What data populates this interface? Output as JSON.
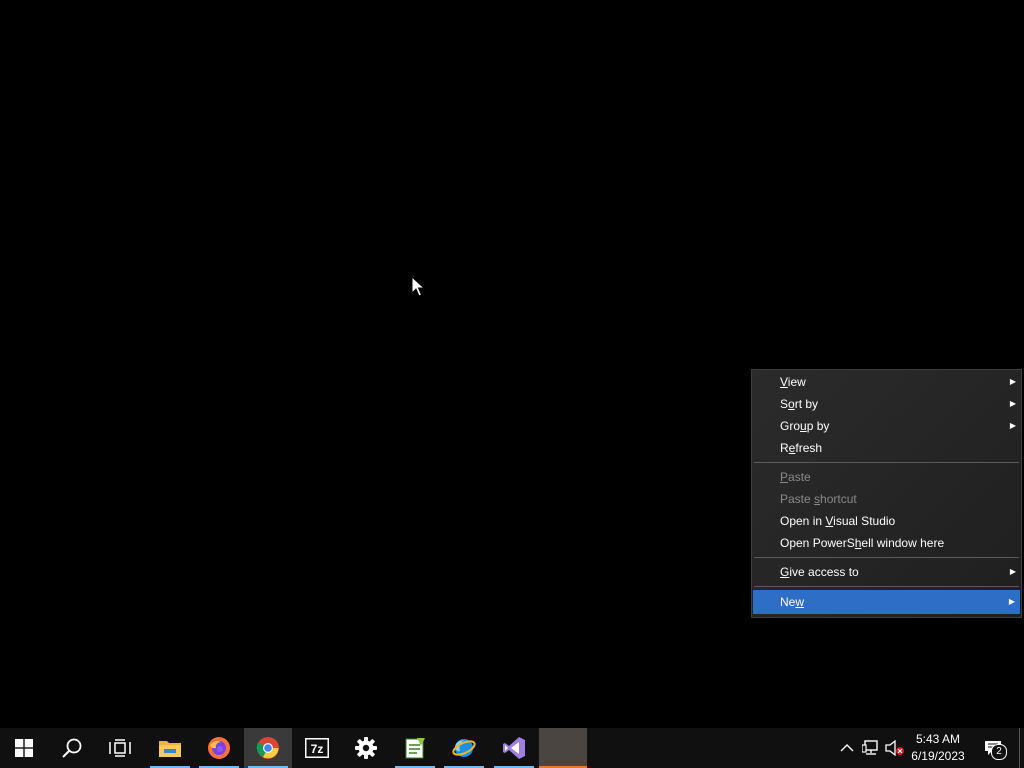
{
  "context_menu": {
    "items": [
      {
        "pre": "",
        "u": "V",
        "post": "iew",
        "submenu": true
      },
      {
        "pre": "S",
        "u": "o",
        "post": "rt by",
        "submenu": true
      },
      {
        "pre": "Gro",
        "u": "u",
        "post": "p by",
        "submenu": true
      },
      {
        "pre": "R",
        "u": "e",
        "post": "fresh",
        "submenu": false
      },
      {
        "pre": "",
        "u": "P",
        "post": "aste",
        "submenu": false,
        "disabled": true
      },
      {
        "pre": "Paste ",
        "u": "s",
        "post": "hortcut",
        "submenu": false,
        "disabled": true
      },
      {
        "pre": "Open in ",
        "u": "V",
        "post": "isual Studio",
        "submenu": false
      },
      {
        "pre": "Open PowerS",
        "u": "h",
        "post": "ell window here",
        "submenu": false
      },
      {
        "pre": "",
        "u": "G",
        "post": "ive access to",
        "submenu": true
      },
      {
        "pre": "Ne",
        "u": "w",
        "post": "",
        "submenu": true,
        "highlighted": true
      }
    ],
    "highlight_color": "#2f6ec7"
  },
  "taskbar": {
    "apps": [
      {
        "icon": "windows-start-icon"
      },
      {
        "icon": "search-icon"
      },
      {
        "icon": "task-view-icon"
      },
      {
        "icon": "file-explorer-icon"
      },
      {
        "icon": "firefox-icon"
      },
      {
        "icon": "chrome-icon",
        "active": true
      },
      {
        "icon": "7zip-icon"
      },
      {
        "icon": "settings-gear-icon"
      },
      {
        "icon": "notepad-plus-plus-icon"
      },
      {
        "icon": "internet-explorer-icon"
      },
      {
        "icon": "visual-studio-icon"
      },
      {
        "icon": "blank-app-icon"
      }
    ],
    "tray": {
      "icons": [
        "chevron-up-icon",
        "network-icon",
        "volume-muted-icon"
      ]
    },
    "clock": {
      "time": "5:43 AM",
      "date": "6/19/2023"
    },
    "notifications": {
      "count": "2"
    }
  }
}
